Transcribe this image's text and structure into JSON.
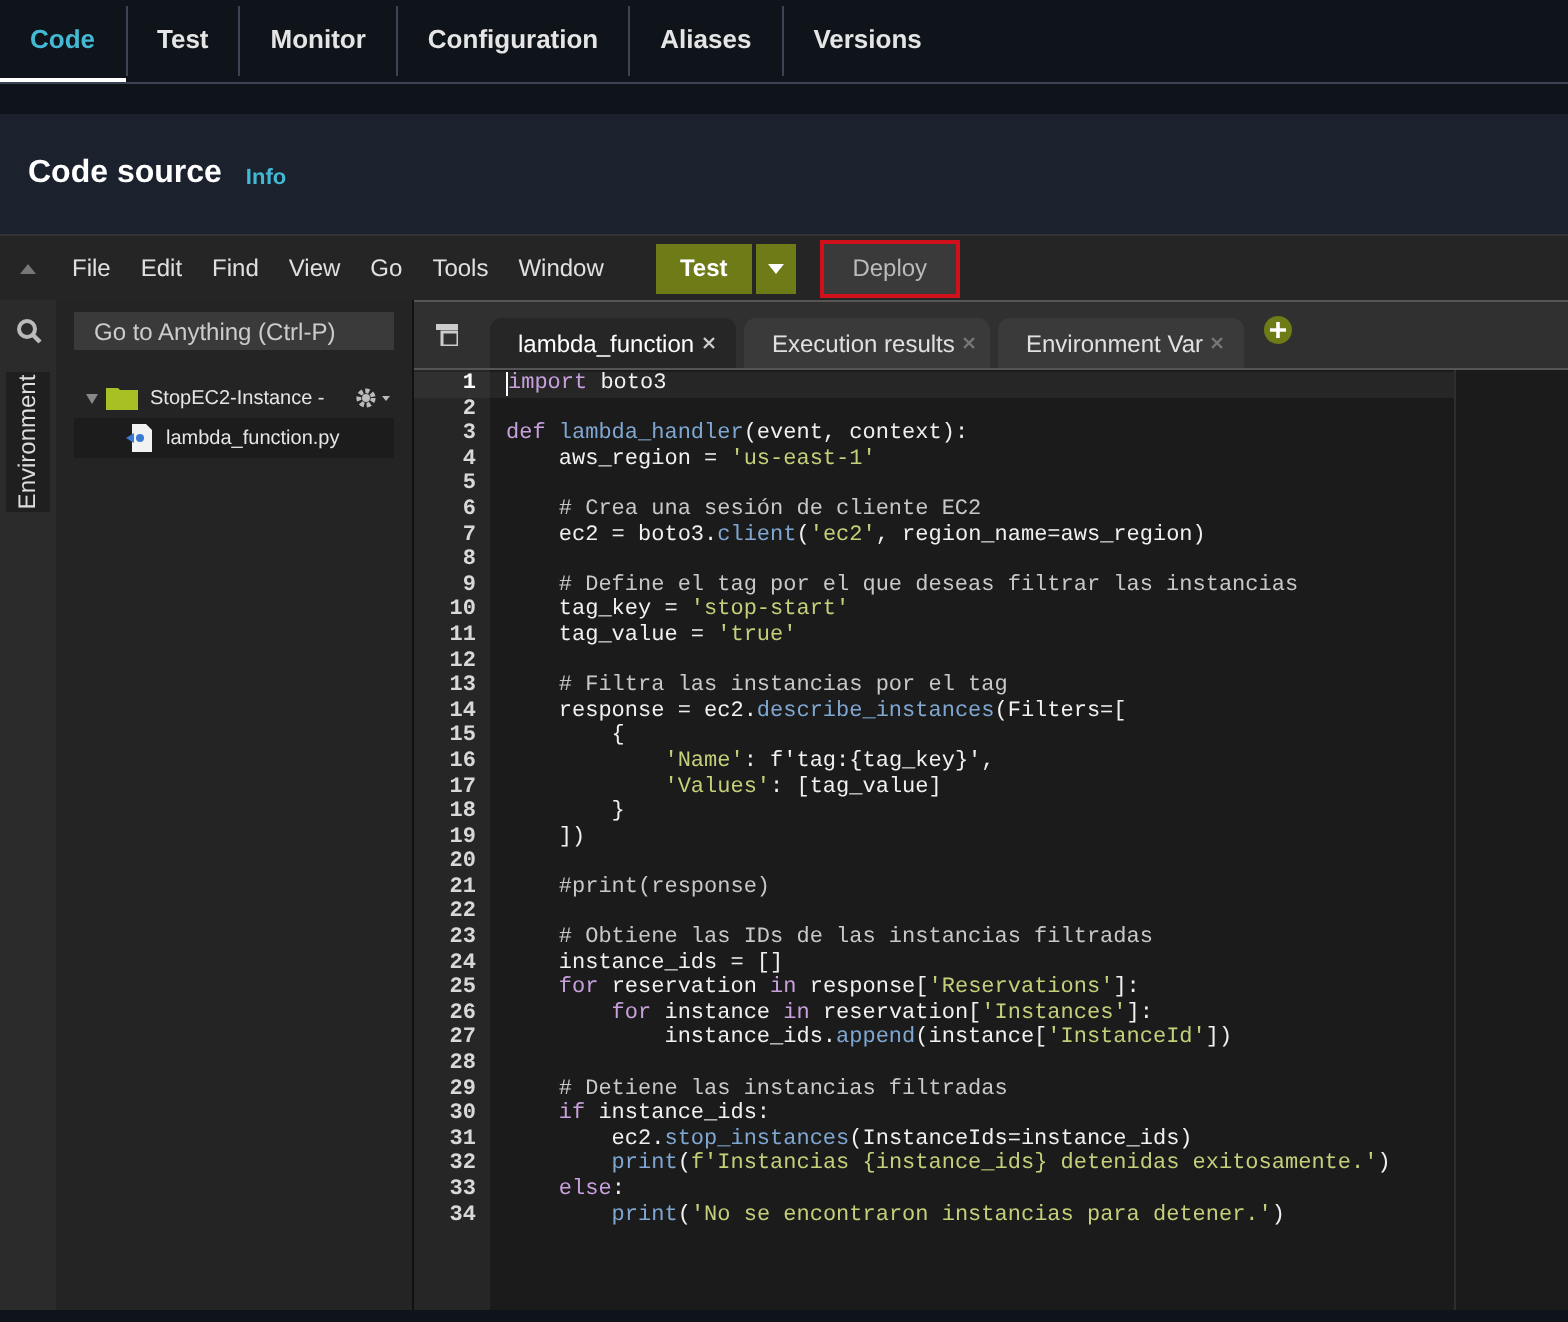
{
  "top_tabs": [
    {
      "label": "Code",
      "selected": true
    },
    {
      "label": "Test",
      "selected": false
    },
    {
      "label": "Monitor",
      "selected": false
    },
    {
      "label": "Configuration",
      "selected": false
    },
    {
      "label": "Aliases",
      "selected": false
    },
    {
      "label": "Versions",
      "selected": false
    }
  ],
  "section": {
    "title": "Code source",
    "info_link": "Info"
  },
  "menu": [
    "File",
    "Edit",
    "Find",
    "View",
    "Go",
    "Tools",
    "Window"
  ],
  "test_button": "Test",
  "deploy_button": {
    "label": "Deploy",
    "highlighted": true
  },
  "sidebar": {
    "search_placeholder": "Go to Anything (Ctrl-P)",
    "panel_label": "Environment",
    "tree": [
      {
        "label": "StopEC2-Instance -",
        "expanded": true,
        "children": [
          {
            "label": "lambda_function.py",
            "selected": true
          }
        ]
      }
    ]
  },
  "editor": {
    "tabs": [
      {
        "label": "lambda_function",
        "selected": true
      },
      {
        "label": "Execution results",
        "selected": false
      },
      {
        "label": "Environment Var",
        "selected": false
      }
    ],
    "lines": [
      {
        "number": "1",
        "active": true,
        "tokens": [
          {
            "kind": "keyword",
            "text": "import"
          },
          {
            "kind": "plain",
            "text": " boto3"
          }
        ]
      },
      {
        "number": "2",
        "active": false
      },
      {
        "number": "3",
        "active": false,
        "tokens": [
          {
            "kind": "keyword",
            "text": "def "
          },
          {
            "kind": "call",
            "text": "lambda_handler"
          },
          {
            "kind": "plain",
            "text": "(event, context):"
          }
        ]
      },
      {
        "number": "4",
        "active": false,
        "tokens": [
          {
            "kind": "plain",
            "text": "    aws_region = "
          },
          {
            "kind": "string",
            "text": "'us-east-1'"
          }
        ]
      },
      {
        "number": "5",
        "active": false
      },
      {
        "number": "6",
        "active": false,
        "tokens": [
          {
            "kind": "comment",
            "text": "    # Crea una sesión de cliente EC2"
          }
        ]
      },
      {
        "number": "7",
        "active": false,
        "tokens": [
          {
            "kind": "plain",
            "text": "    ec2 = boto3."
          },
          {
            "kind": "call",
            "text": "client"
          },
          {
            "kind": "plain",
            "text": "("
          },
          {
            "kind": "string",
            "text": "'ec2'"
          },
          {
            "kind": "plain",
            "text": ", region_name=aws_region)"
          }
        ]
      },
      {
        "number": "8",
        "active": false
      },
      {
        "number": "9",
        "active": false,
        "tokens": [
          {
            "kind": "comment",
            "text": "    # Define el tag por el que deseas filtrar las instancias"
          }
        ]
      },
      {
        "number": "10",
        "active": false,
        "tokens": [
          {
            "kind": "plain",
            "text": "    tag_key = "
          },
          {
            "kind": "string",
            "text": "'stop-start'"
          }
        ]
      },
      {
        "number": "11",
        "active": false,
        "tokens": [
          {
            "kind": "plain",
            "text": "    tag_value = "
          },
          {
            "kind": "string",
            "text": "'true'"
          }
        ]
      },
      {
        "number": "12",
        "active": false
      },
      {
        "number": "13",
        "active": false,
        "tokens": [
          {
            "kind": "comment",
            "text": "    # Filtra las instancias por el tag"
          }
        ]
      },
      {
        "number": "14",
        "active": false,
        "tokens": [
          {
            "kind": "plain",
            "text": "    response = ec2."
          },
          {
            "kind": "call",
            "text": "describe_instances"
          },
          {
            "kind": "plain",
            "text": "(Filters=["
          }
        ]
      },
      {
        "number": "15",
        "active": false,
        "tokens": [
          {
            "kind": "plain",
            "text": "        {"
          }
        ]
      },
      {
        "number": "16",
        "active": false,
        "tokens": [
          {
            "kind": "string",
            "text": "            'Name'"
          },
          {
            "kind": "plain",
            "text": ": f'tag:{tag_key}',"
          }
        ]
      },
      {
        "number": "17",
        "active": false,
        "tokens": [
          {
            "kind": "string",
            "text": "            'Values'"
          },
          {
            "kind": "plain",
            "text": ": [tag_value]"
          }
        ]
      },
      {
        "number": "18",
        "active": false,
        "tokens": [
          {
            "kind": "plain",
            "text": "        }"
          }
        ]
      },
      {
        "number": "19",
        "active": false,
        "tokens": [
          {
            "kind": "plain",
            "text": "    ])"
          }
        ]
      },
      {
        "number": "20",
        "active": false
      },
      {
        "number": "21",
        "active": false,
        "tokens": [
          {
            "kind": "comment",
            "text": "    #print(response)"
          }
        ]
      },
      {
        "number": "22",
        "active": false
      },
      {
        "number": "23",
        "active": false,
        "tokens": [
          {
            "kind": "comment",
            "text": "    # Obtiene las IDs de las instancias filtradas"
          }
        ]
      },
      {
        "number": "24",
        "active": false,
        "tokens": [
          {
            "kind": "plain",
            "text": "    instance_ids = []"
          }
        ]
      },
      {
        "number": "25",
        "active": false,
        "tokens": [
          {
            "kind": "keyword",
            "text": "    for"
          },
          {
            "kind": "plain",
            "text": " reservation "
          },
          {
            "kind": "keyword",
            "text": "in"
          },
          {
            "kind": "plain",
            "text": " response["
          },
          {
            "kind": "string",
            "text": "'Reservations'"
          },
          {
            "kind": "plain",
            "text": "]:"
          }
        ]
      },
      {
        "number": "26",
        "active": false,
        "tokens": [
          {
            "kind": "keyword",
            "text": "        for"
          },
          {
            "kind": "plain",
            "text": " instance "
          },
          {
            "kind": "keyword",
            "text": "in"
          },
          {
            "kind": "plain",
            "text": " reservation["
          },
          {
            "kind": "string",
            "text": "'Instances'"
          },
          {
            "kind": "plain",
            "text": "]:"
          }
        ]
      },
      {
        "number": "27",
        "active": false,
        "tokens": [
          {
            "kind": "plain",
            "text": "            instance_ids."
          },
          {
            "kind": "call",
            "text": "append"
          },
          {
            "kind": "plain",
            "text": "(instance["
          },
          {
            "kind": "string",
            "text": "'InstanceId'"
          },
          {
            "kind": "plain",
            "text": "])"
          }
        ]
      },
      {
        "number": "28",
        "active": false
      },
      {
        "number": "29",
        "active": false,
        "tokens": [
          {
            "kind": "comment",
            "text": "    # Detiene las instancias filtradas"
          }
        ]
      },
      {
        "number": "30",
        "active": false,
        "tokens": [
          {
            "kind": "keyword",
            "text": "    if"
          },
          {
            "kind": "plain",
            "text": " instance_ids:"
          }
        ]
      },
      {
        "number": "31",
        "active": false,
        "tokens": [
          {
            "kind": "plain",
            "text": "        ec2."
          },
          {
            "kind": "call",
            "text": "stop_instances"
          },
          {
            "kind": "plain",
            "text": "(InstanceIds=instance_ids)"
          }
        ]
      },
      {
        "number": "32",
        "active": false,
        "tokens": [
          {
            "kind": "call",
            "text": "        print"
          },
          {
            "kind": "plain",
            "text": "("
          },
          {
            "kind": "string",
            "text": "f'Instancias {instance_ids} detenidas exitosamente.'"
          },
          {
            "kind": "plain",
            "text": ")"
          }
        ]
      },
      {
        "number": "33",
        "active": false,
        "tokens": [
          {
            "kind": "keyword",
            "text": "    else"
          },
          {
            "kind": "plain",
            "text": ":"
          }
        ]
      },
      {
        "number": "34",
        "active": false,
        "tokens": [
          {
            "kind": "call",
            "text": "        print"
          },
          {
            "kind": "plain",
            "text": "("
          },
          {
            "kind": "string",
            "text": "'No se encontraron instancias para detener.'"
          },
          {
            "kind": "plain",
            "text": ")"
          }
        ]
      }
    ]
  }
}
